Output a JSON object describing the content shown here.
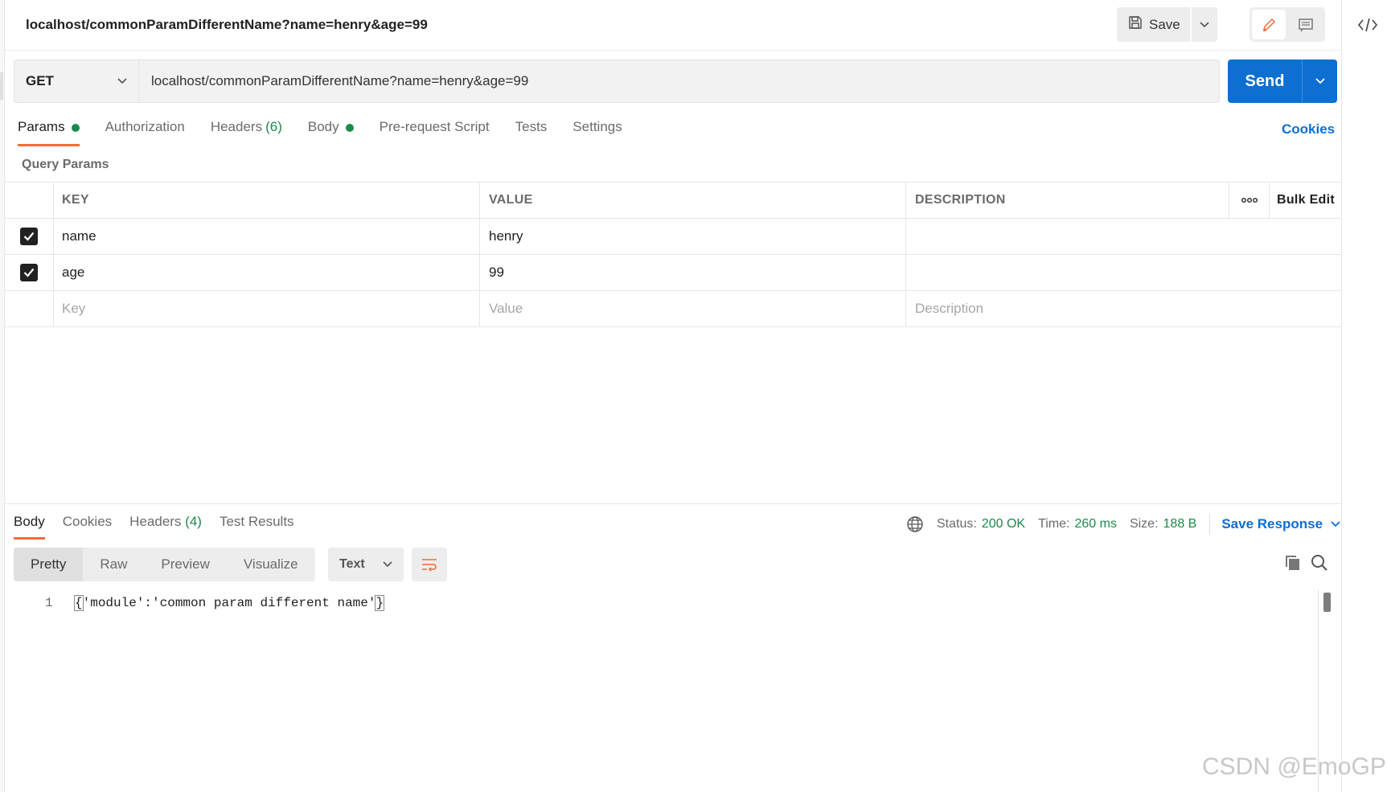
{
  "header": {
    "request_title": "localhost/commonParamDifferentName?name=henry&age=99",
    "save_label": "Save"
  },
  "url_bar": {
    "method": "GET",
    "url": "localhost/commonParamDifferentName?name=henry&age=99",
    "send_label": "Send"
  },
  "request_tabs": [
    {
      "label": "Params",
      "dot": true,
      "active": true
    },
    {
      "label": "Authorization"
    },
    {
      "label": "Headers",
      "count": "(6)"
    },
    {
      "label": "Body",
      "dot": true
    },
    {
      "label": "Pre-request Script"
    },
    {
      "label": "Tests"
    },
    {
      "label": "Settings"
    }
  ],
  "cookies_label": "Cookies",
  "query_params": {
    "label": "Query Params",
    "columns": {
      "key": "KEY",
      "value": "VALUE",
      "description": "DESCRIPTION",
      "bulk_edit": "Bulk Edit"
    },
    "rows": [
      {
        "checked": true,
        "key": "name",
        "value": "henry",
        "description": ""
      },
      {
        "checked": true,
        "key": "age",
        "value": "99",
        "description": ""
      }
    ],
    "placeholders": {
      "key": "Key",
      "value": "Value",
      "description": "Description"
    }
  },
  "response": {
    "tabs": [
      {
        "label": "Body",
        "active": true
      },
      {
        "label": "Cookies"
      },
      {
        "label": "Headers",
        "count": "(4)"
      },
      {
        "label": "Test Results"
      }
    ],
    "status_label": "Status:",
    "status_value": "200 OK",
    "time_label": "Time:",
    "time_value": "260 ms",
    "size_label": "Size:",
    "size_value": "188 B",
    "save_response_label": "Save Response",
    "format_buttons": [
      "Pretty",
      "Raw",
      "Preview",
      "Visualize"
    ],
    "active_format": "Pretty",
    "type_select": "Text",
    "code_lines": [
      {
        "no": "1",
        "open": "{",
        "text": "'module':'common param different name'",
        "close": "}"
      }
    ]
  },
  "watermark": "CSDN @EmoGP",
  "colors": {
    "accent_orange": "#f26b3a",
    "primary_blue": "#0c6fd1",
    "success_green": "#1a8a4a"
  },
  "icons": [
    "save-icon",
    "chevron-down-icon",
    "pencil-icon",
    "comment-icon",
    "code-icon",
    "more-icon",
    "globe-icon",
    "wrap-icon",
    "copy-icon",
    "search-icon",
    "check-icon"
  ]
}
